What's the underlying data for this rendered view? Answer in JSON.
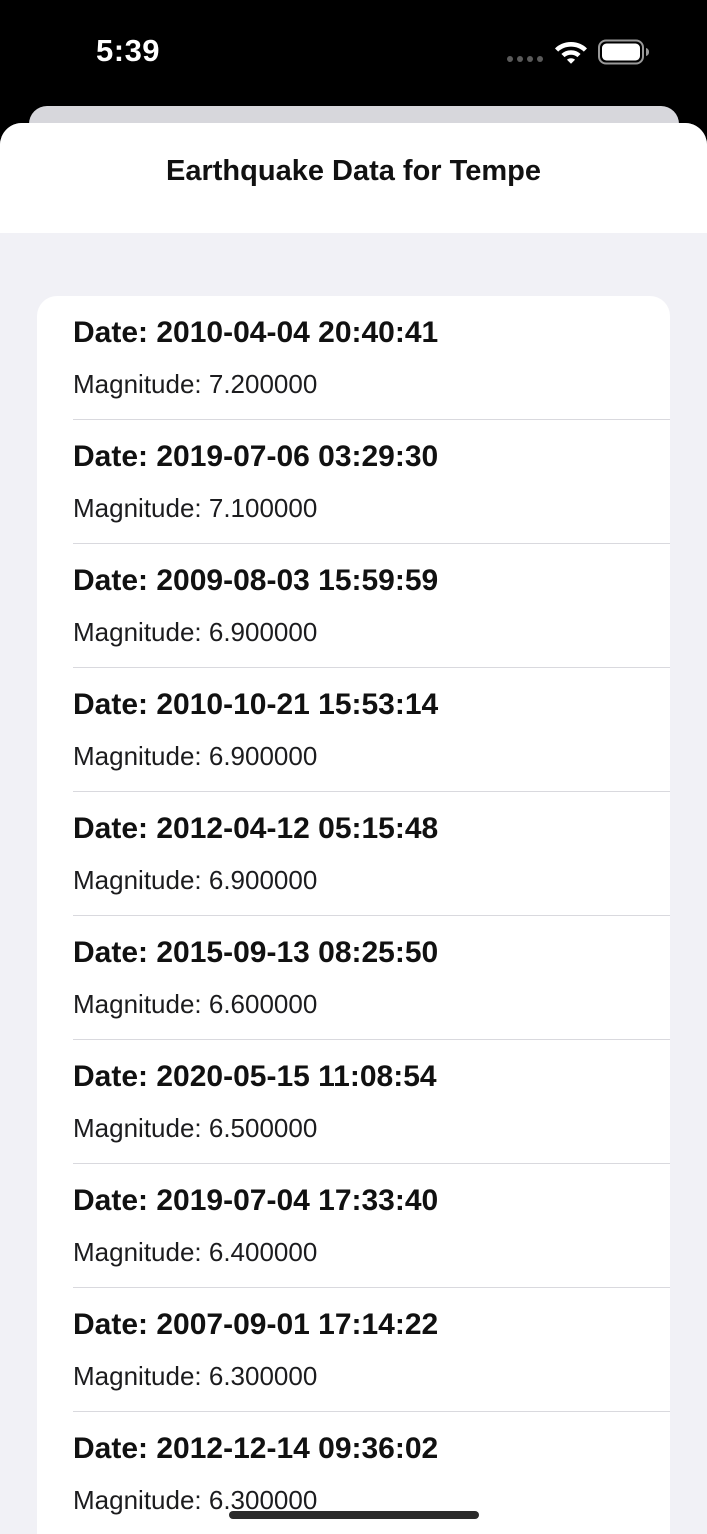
{
  "status_bar": {
    "time": "5:39",
    "icons": [
      "cellular-icon",
      "wifi-icon",
      "battery-icon"
    ]
  },
  "navigation": {
    "title": "Earthquake Data for Tempe"
  },
  "earthquakes": [
    {
      "date": "Date: 2010-04-04 20:40:41",
      "magnitude": "Magnitude: 7.200000"
    },
    {
      "date": "Date: 2019-07-06 03:29:30",
      "magnitude": "Magnitude: 7.100000"
    },
    {
      "date": "Date: 2009-08-03 15:59:59",
      "magnitude": "Magnitude: 6.900000"
    },
    {
      "date": "Date: 2010-10-21 15:53:14",
      "magnitude": "Magnitude: 6.900000"
    },
    {
      "date": "Date: 2012-04-12 05:15:48",
      "magnitude": "Magnitude: 6.900000"
    },
    {
      "date": "Date: 2015-09-13 08:25:50",
      "magnitude": "Magnitude: 6.600000"
    },
    {
      "date": "Date: 2020-05-15 11:08:54",
      "magnitude": "Magnitude: 6.500000"
    },
    {
      "date": "Date: 2019-07-04 17:33:40",
      "magnitude": "Magnitude: 6.400000"
    },
    {
      "date": "Date: 2007-09-01 17:14:22",
      "magnitude": "Magnitude: 6.300000"
    },
    {
      "date": "Date: 2012-12-14 09:36:02",
      "magnitude": "Magnitude: 6.300000"
    }
  ],
  "colors": {
    "background": "#f1f1f6",
    "card": "#ffffff",
    "text_primary": "#111111",
    "divider": "#d9d9de"
  }
}
